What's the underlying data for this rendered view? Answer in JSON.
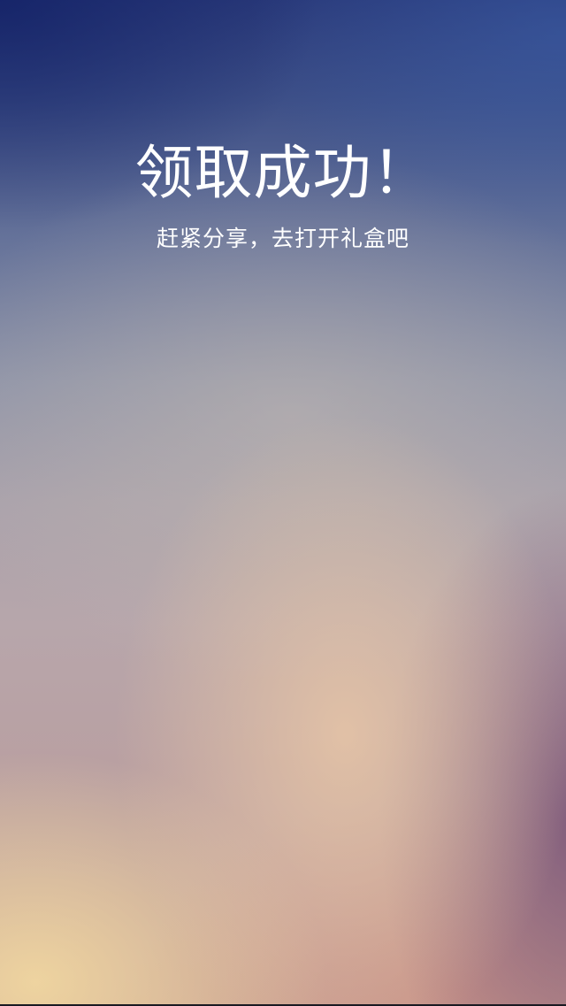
{
  "page": {
    "title": "领取成功！",
    "subtitle": "赶紧分享，去打开礼盒吧"
  },
  "colors": {
    "text": "#ffffff",
    "top_blue": "#2a3a7a",
    "warm_glow": "#e8c6a6",
    "bottom_left_glow": "#f0d6a0",
    "right_plum": "#785276"
  }
}
